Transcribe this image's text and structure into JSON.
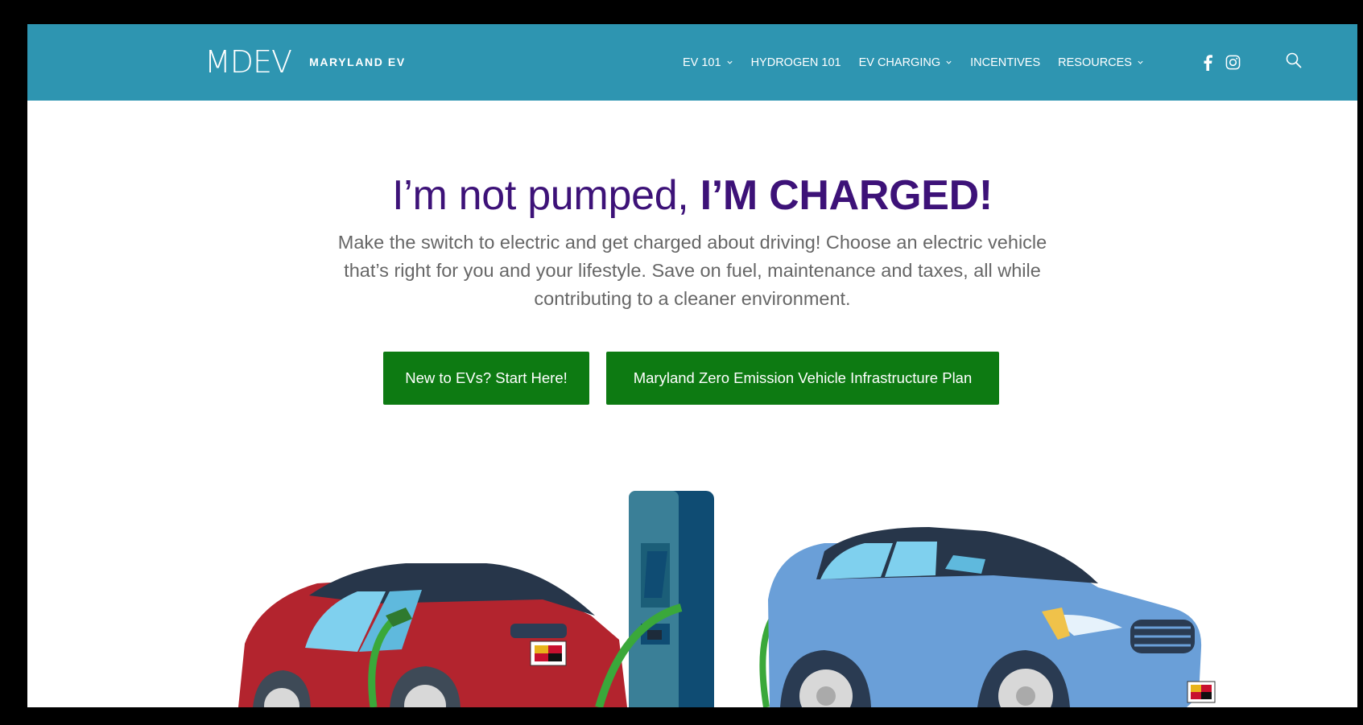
{
  "header": {
    "logo_mark": "MDEV",
    "logo_text": "MARYLAND EV",
    "nav": [
      {
        "label": "EV 101",
        "has_dropdown": true
      },
      {
        "label": "HYDROGEN 101",
        "has_dropdown": false
      },
      {
        "label": "EV CHARGING",
        "has_dropdown": true
      },
      {
        "label": "INCENTIVES",
        "has_dropdown": false
      },
      {
        "label": "RESOURCES",
        "has_dropdown": true
      }
    ],
    "social_icons": [
      "facebook-icon",
      "instagram-icon"
    ],
    "search_icon": "search-icon",
    "background_color": "#2e95b1"
  },
  "hero": {
    "title_light": "I’m not pumped, ",
    "title_bold": "I’M CHARGED!",
    "subtitle": "Make the switch to electric and get charged about driving! Choose an electric vehicle that’s right for you and your lifestyle. Save on fuel, maintenance and taxes, all while contributing to a cleaner environment.",
    "title_color": "#3d1278",
    "buttons": [
      {
        "label": "New to EVs?  Start Here!"
      },
      {
        "label": "Maryland Zero Emission Vehicle Infrastructure Plan"
      }
    ],
    "button_color": "#0d7a12"
  },
  "illustration": {
    "description_icon": "ev-charging-station-illustration"
  }
}
